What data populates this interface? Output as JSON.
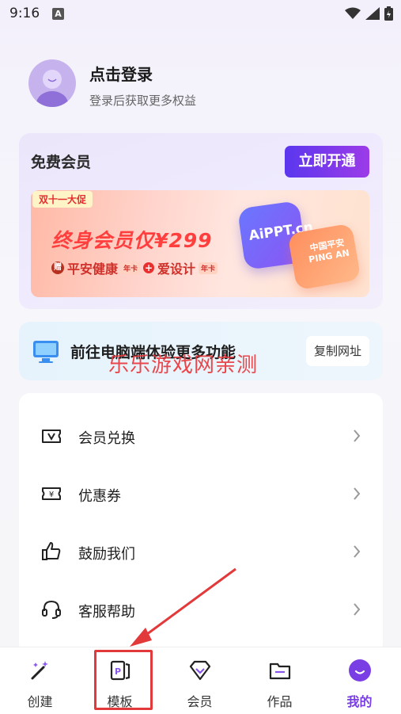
{
  "status_bar": {
    "time": "9:16",
    "notif_letter": "A"
  },
  "profile": {
    "title": "点击登录",
    "subtitle": "登录后获取更多权益"
  },
  "vip_card": {
    "title": "免费会员",
    "cta_label": "立即开通",
    "promo": {
      "tag": "双十一大促",
      "headline": "终身会员仅¥299",
      "gift1_badge": "赠",
      "gift1": "平安健康",
      "gift1_note": "年卡",
      "gift2": "爱设计",
      "gift2_note": "年卡",
      "tile1_text": "AiPPT.cn",
      "tile2_text": "中国平安 PING AN"
    }
  },
  "pc_banner": {
    "text": "前往电脑端体验更多功能",
    "copy_label": "复制网址"
  },
  "watermark": "乐乐游戏网亲测",
  "menu": {
    "items": [
      {
        "label": "会员兑换",
        "icon": "ticket-v-icon"
      },
      {
        "label": "优惠券",
        "icon": "coupon-icon"
      },
      {
        "label": "鼓励我们",
        "icon": "thumbs-up-icon"
      },
      {
        "label": "客服帮助",
        "icon": "headset-icon"
      }
    ]
  },
  "nav": {
    "items": [
      {
        "label": "创建",
        "icon": "magic-wand-icon"
      },
      {
        "label": "模板",
        "icon": "template-icon"
      },
      {
        "label": "会员",
        "icon": "diamond-icon"
      },
      {
        "label": "作品",
        "icon": "folder-icon"
      },
      {
        "label": "我的",
        "icon": "profile-face-icon"
      }
    ],
    "active_index": 4
  },
  "colors": {
    "accent": "#7a3fe4",
    "annotation": "#e23a3a"
  }
}
